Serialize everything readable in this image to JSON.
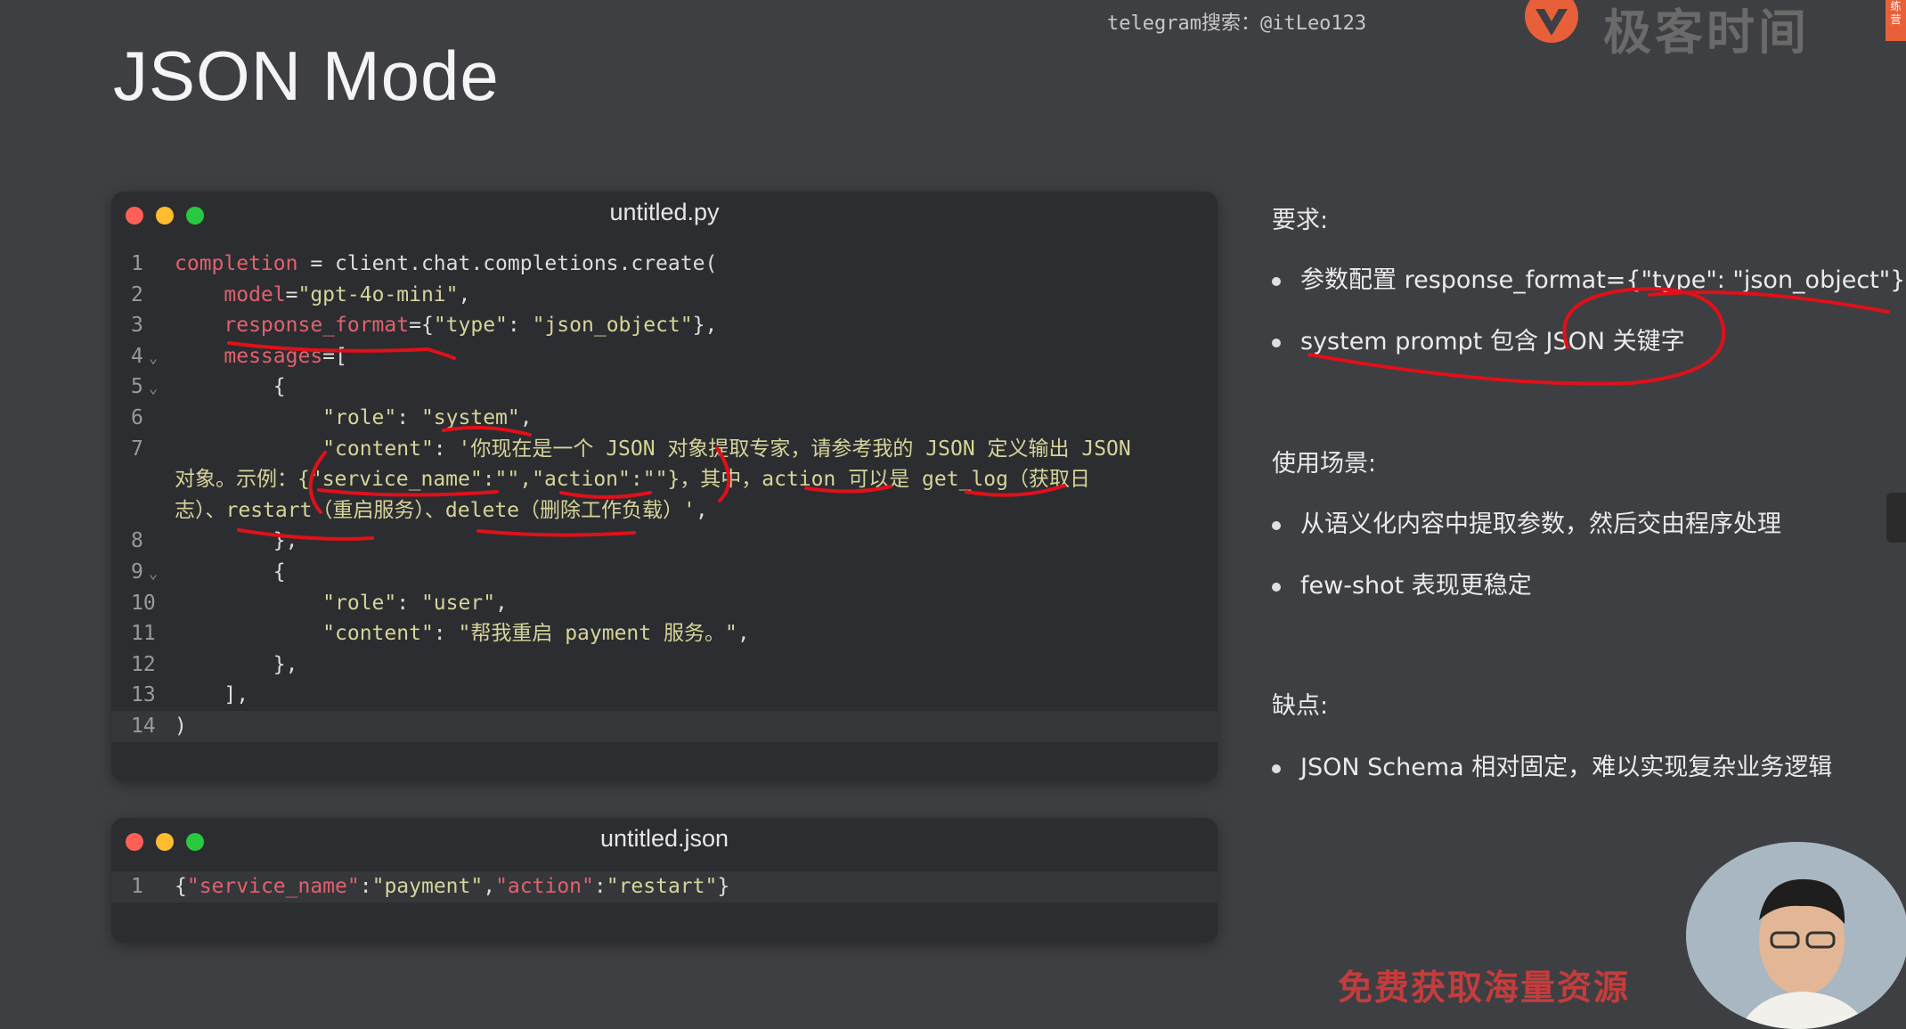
{
  "slide": {
    "title": "JSON Mode"
  },
  "watermark": {
    "telegram": "telegram搜索：@itLeo123",
    "brand": "极客时间",
    "badge_line1": "练",
    "badge_line2": "营",
    "promo": "免费获取海量资源"
  },
  "editor_py": {
    "filename": "untitled.py",
    "lines": [
      {
        "num": "1",
        "fold": "",
        "tokens": [
          [
            "c-var",
            "completion"
          ],
          [
            "c-plain",
            " = client.chat.completions.create("
          ]
        ]
      },
      {
        "num": "2",
        "fold": "",
        "tokens": [
          [
            "c-var",
            "    model"
          ],
          [
            "c-plain",
            "="
          ],
          [
            "c-str",
            "\"gpt-4o-mini\""
          ],
          [
            "c-plain",
            ","
          ]
        ]
      },
      {
        "num": "3",
        "fold": "",
        "tokens": [
          [
            "c-var",
            "    response_format"
          ],
          [
            "c-plain",
            "={"
          ],
          [
            "c-str",
            "\"type\""
          ],
          [
            "c-plain",
            ": "
          ],
          [
            "c-str",
            "\"json_object\""
          ],
          [
            "c-plain",
            "},"
          ]
        ]
      },
      {
        "num": "4",
        "fold": "⌄",
        "tokens": [
          [
            "c-var",
            "    messages"
          ],
          [
            "c-plain",
            "=["
          ]
        ]
      },
      {
        "num": "5",
        "fold": "⌄",
        "tokens": [
          [
            "c-plain",
            "        {"
          ]
        ]
      },
      {
        "num": "6",
        "fold": "",
        "tokens": [
          [
            "c-str",
            "            \"role\""
          ],
          [
            "c-plain",
            ": "
          ],
          [
            "c-str",
            "\"system\""
          ],
          [
            "c-plain",
            ","
          ]
        ]
      },
      {
        "num": "7",
        "fold": "",
        "tokens": [
          [
            "c-str",
            "            \"content\""
          ],
          [
            "c-plain",
            ": "
          ],
          [
            "c-str",
            "'你现在是一个 JSON 对象提取专家，请参考我的 JSON 定义输出 JSON"
          ]
        ]
      },
      {
        "num": "",
        "fold": "",
        "tokens": [
          [
            "c-str",
            "对象。示例：{\"service_name\":\"\",\"action\":\"\"}，其中，action 可以是 get_log（获取日"
          ]
        ]
      },
      {
        "num": "",
        "fold": "",
        "tokens": [
          [
            "c-str",
            "志）、restart（重启服务）、delete（删除工作负载）'"
          ],
          [
            "c-plain",
            ","
          ]
        ]
      },
      {
        "num": "8",
        "fold": "",
        "tokens": [
          [
            "c-plain",
            "        },"
          ]
        ]
      },
      {
        "num": "9",
        "fold": "⌄",
        "tokens": [
          [
            "c-plain",
            "        {"
          ]
        ]
      },
      {
        "num": "10",
        "fold": "",
        "tokens": [
          [
            "c-str",
            "            \"role\""
          ],
          [
            "c-plain",
            ": "
          ],
          [
            "c-str",
            "\"user\""
          ],
          [
            "c-plain",
            ","
          ]
        ]
      },
      {
        "num": "11",
        "fold": "",
        "tokens": [
          [
            "c-str",
            "            \"content\""
          ],
          [
            "c-plain",
            ": "
          ],
          [
            "c-str",
            "\"帮我重启 payment 服务。\""
          ],
          [
            "c-plain",
            ","
          ]
        ]
      },
      {
        "num": "12",
        "fold": "",
        "tokens": [
          [
            "c-plain",
            "        },"
          ]
        ]
      },
      {
        "num": "13",
        "fold": "",
        "tokens": [
          [
            "c-plain",
            "    ],"
          ]
        ]
      },
      {
        "num": "14",
        "fold": "",
        "tokens": [
          [
            "c-plain",
            ")"
          ]
        ]
      }
    ]
  },
  "editor_json": {
    "filename": "untitled.json",
    "lines": [
      {
        "num": "1",
        "fold": "",
        "tokens": [
          [
            "c-plain",
            "{"
          ],
          [
            "c-var",
            "\"service_name\""
          ],
          [
            "c-plain",
            ":"
          ],
          [
            "c-str",
            "\"payment\""
          ],
          [
            "c-plain",
            ","
          ],
          [
            "c-var",
            "\"action\""
          ],
          [
            "c-plain",
            ":"
          ],
          [
            "c-str",
            "\"restart\""
          ],
          [
            "c-plain",
            "}"
          ]
        ]
      }
    ]
  },
  "panel": {
    "requirements_heading": "要求:",
    "req_item_1": "参数配置 response_format={\"type\": \"json_object\"}",
    "req_item_2": "system prompt 包含 JSON 关键字",
    "usage_heading": "使用场景:",
    "usage_item_1": "从语义化内容中提取参数，然后交由程序处理",
    "usage_item_2": "few-shot 表现更稳定",
    "cons_heading": "缺点:",
    "cons_item_1": "JSON Schema 相对固定，难以实现复杂业务逻辑"
  },
  "colors": {
    "background": "#3e3f42",
    "editor_bg": "#2c2d30",
    "variable": "#e0626e",
    "string": "#d6d49a",
    "annotation": "#e0101a"
  }
}
